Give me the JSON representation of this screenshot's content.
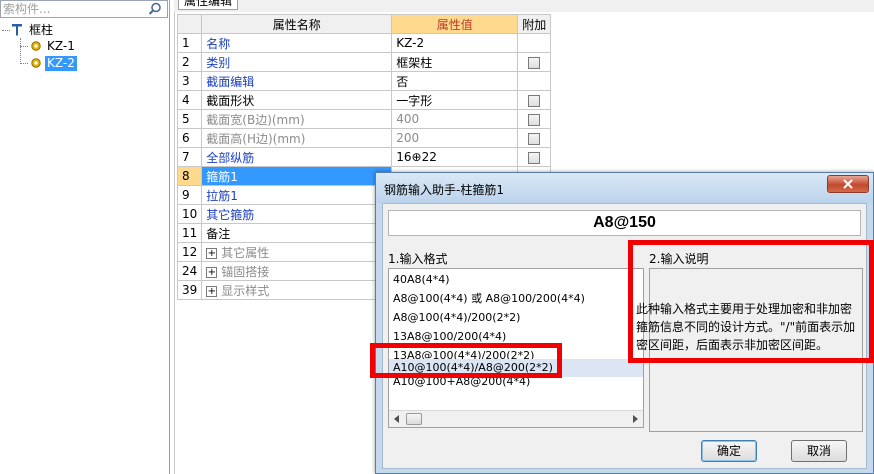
{
  "search": {
    "placeholder": "索构件..."
  },
  "tree": {
    "root": "框柱",
    "children": [
      "KZ-1",
      "KZ-2"
    ],
    "selected": "KZ-2"
  },
  "tab": {
    "label": "属性编辑"
  },
  "grid": {
    "headers": {
      "name": "属性名称",
      "value": "属性值",
      "add": "附加"
    },
    "rows": [
      {
        "num": "1",
        "name": "名称",
        "value": "KZ-2"
      },
      {
        "num": "2",
        "name": "类别",
        "value": "框架柱"
      },
      {
        "num": "3",
        "name": "截面编辑",
        "value": "否"
      },
      {
        "num": "4",
        "name": "截面形状",
        "value": "一字形"
      },
      {
        "num": "5",
        "name": "截面宽(B边)(mm)",
        "value": "400"
      },
      {
        "num": "6",
        "name": "截面高(H边)(mm)",
        "value": "200"
      },
      {
        "num": "7",
        "name": "全部纵筋",
        "value": "16⊕22"
      },
      {
        "num": "8",
        "name": "箍筋1",
        "value": ""
      },
      {
        "num": "9",
        "name": "拉筋1",
        "value": ""
      },
      {
        "num": "10",
        "name": "其它箍筋",
        "value": ""
      },
      {
        "num": "11",
        "name": "备注",
        "value": ""
      },
      {
        "num": "12",
        "name": "其它属性",
        "value": ""
      },
      {
        "num": "24",
        "name": "锚固搭接",
        "value": ""
      },
      {
        "num": "39",
        "name": "显示样式",
        "value": ""
      }
    ]
  },
  "dialog": {
    "title": "钢筋输入助手-柱箍筋1",
    "formula": "A8@150",
    "section1_label": "1.输入格式",
    "section2_label": "2.输入说明",
    "formats": [
      "40A8(4*4)",
      "A8@100(4*4) 或 A8@100/200(4*4)",
      "A8@100(4*4)/200(2*2)",
      "13A8@100/200(4*4)",
      "13A8@100(4*4)/200(2*2)",
      "A10@100(4*4)/A8@200(2*2)",
      "A10@100+A8@200(4*4)"
    ],
    "description": "此种输入格式主要用于处理加密和非加密箍筋信息不同的设计方式。\"/\"前面表示加密区间距，后面表示非加密区间距。",
    "ok_label": "确定",
    "cancel_label": "取消"
  },
  "colors": {
    "annotation": "#f00000",
    "selection": "#3399ff",
    "header_value_bg": "#ffd98e",
    "header_value_text": "#c0392b",
    "link_text": "#1b3fc0"
  }
}
